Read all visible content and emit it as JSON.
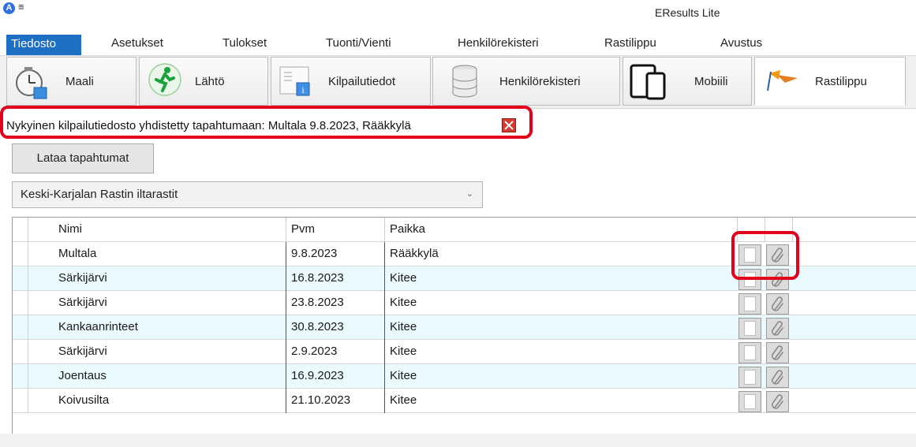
{
  "window": {
    "title": "EResults Lite",
    "app_icon": "A"
  },
  "menu": {
    "items": [
      "Tiedosto",
      "Asetukset",
      "Tulokset",
      "Tuonti/Vienti",
      "Henkilörekisteri",
      "Rastilippu",
      "Avustus"
    ],
    "active": "Tiedosto"
  },
  "toolbar": {
    "buttons": [
      {
        "label": "Maali",
        "icon": "stopwatch-icon"
      },
      {
        "label": "Lähtö",
        "icon": "runner-icon"
      },
      {
        "label": "Kilpailutiedot",
        "icon": "info-document-icon"
      },
      {
        "label": "Henkilörekisteri",
        "icon": "database-icon"
      },
      {
        "label": "Mobiili",
        "icon": "mobile-devices-icon"
      },
      {
        "label": "Rastilippu",
        "icon": "rastilippu-flag-icon"
      }
    ],
    "active": "Rastilippu"
  },
  "info": {
    "text": "Nykyinen kilpailutiedosto yhdistetty tapahtumaan: Multala 9.8.2023, Rääkkylä"
  },
  "load_button": {
    "label": "Lataa tapahtumat"
  },
  "event_select": {
    "value": "Keski-Karjalan Rastin iltarastit"
  },
  "grid": {
    "columns": [
      "Nimi",
      "Pvm",
      "Paikka"
    ],
    "rows": [
      {
        "nimi": "Multala",
        "pvm": "9.8.2023",
        "paikka": "Rääkkylä"
      },
      {
        "nimi": "Särkijärvi",
        "pvm": "16.8.2023",
        "paikka": "Kitee"
      },
      {
        "nimi": "Särkijärvi",
        "pvm": "23.8.2023",
        "paikka": "Kitee"
      },
      {
        "nimi": "Kankaanrinteet",
        "pvm": "30.8.2023",
        "paikka": "Kitee"
      },
      {
        "nimi": "Särkijärvi",
        "pvm": "2.9.2023",
        "paikka": "Kitee"
      },
      {
        "nimi": "Joentaus",
        "pvm": "16.9.2023",
        "paikka": "Kitee"
      },
      {
        "nimi": "Koivusilta",
        "pvm": "21.10.2023",
        "paikka": "Kitee"
      }
    ]
  },
  "colors": {
    "highlight": "#e3001b",
    "menu_active": "#1d6fc4",
    "alt_row": "#eafaff"
  }
}
